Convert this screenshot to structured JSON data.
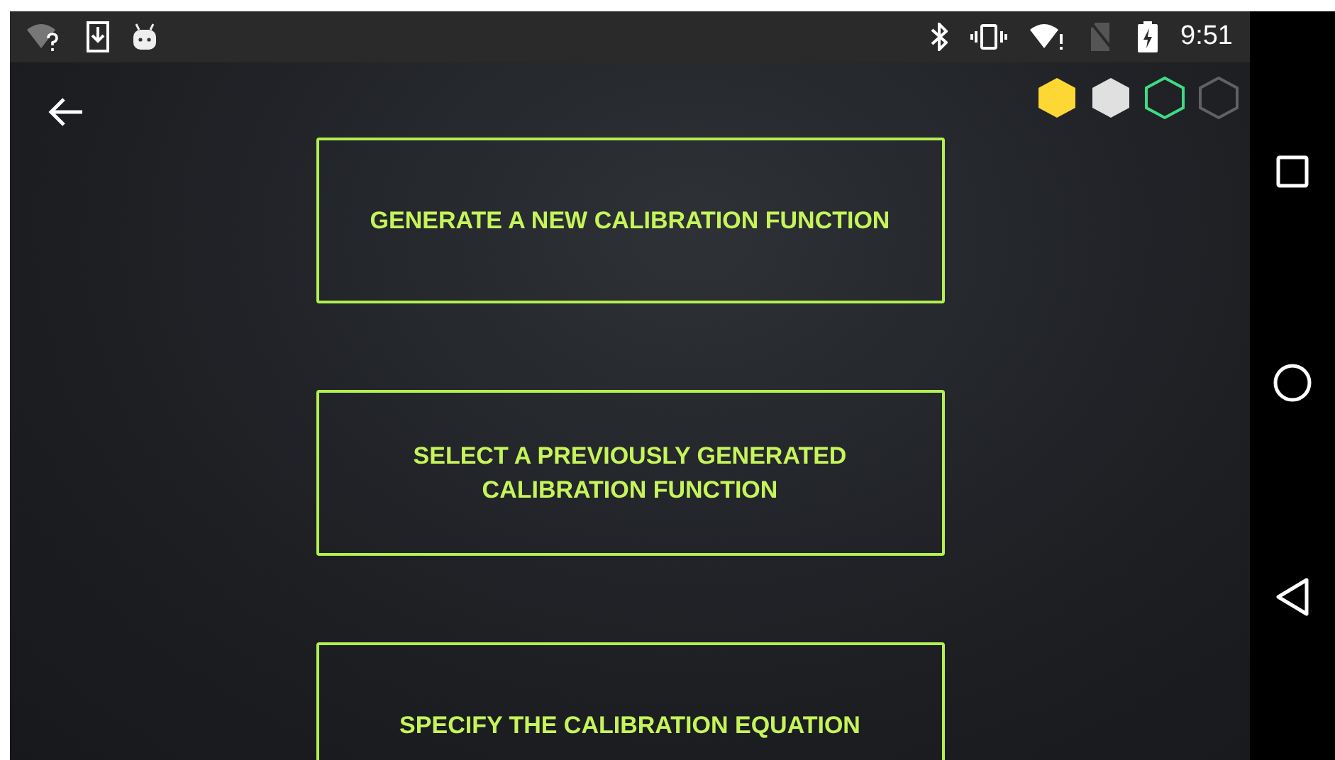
{
  "status_bar": {
    "time": "9:51"
  },
  "indicators": [
    {
      "kind": "filled",
      "color": "#fdd835"
    },
    {
      "kind": "filled",
      "color": "#e0e0e0"
    },
    {
      "kind": "outline",
      "color": "#3ddc84"
    },
    {
      "kind": "outline",
      "color": "#616161"
    }
  ],
  "options": [
    {
      "label": "GENERATE A NEW CALIBRATION FUNCTION"
    },
    {
      "label": "SELECT A PREVIOUSLY GENERATED CALIBRATION FUNCTION"
    },
    {
      "label": "SPECIFY THE CALIBRATION EQUATION"
    }
  ]
}
